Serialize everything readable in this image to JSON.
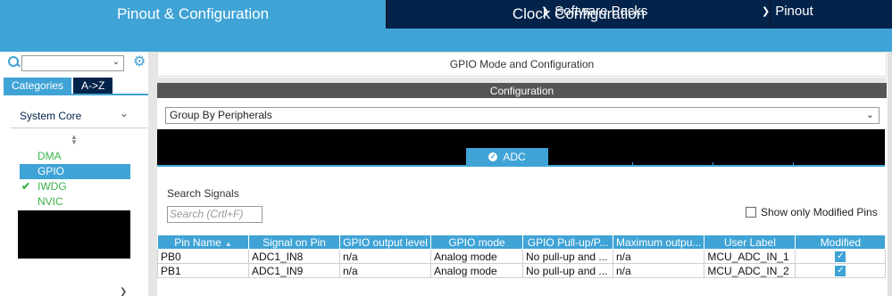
{
  "top_tabs": {
    "pinout": "Pinout & Configuration",
    "clock": "Clock Configuration"
  },
  "sub_menu": {
    "software_packs": "Software Packs",
    "pinout": "Pinout"
  },
  "left_panel": {
    "search_value": "",
    "categories_tab": "Categories",
    "az_tab": "A->Z",
    "section_title": "System Core",
    "items": [
      {
        "label": "DMA",
        "checked": false,
        "selected": false
      },
      {
        "label": "GPIO",
        "checked": false,
        "selected": true
      },
      {
        "label": "IWDG",
        "checked": true,
        "selected": false
      },
      {
        "label": "NVIC",
        "checked": false,
        "selected": false
      }
    ]
  },
  "main": {
    "title": "GPIO Mode and Configuration",
    "config_header": "Configuration",
    "group_by": "Group By Peripherals",
    "active_tab": "ADC",
    "search_signals_label": "Search Signals",
    "search_placeholder": "Search (Crtl+F)",
    "show_modified_label": "Show only Modified Pins",
    "table": {
      "columns": [
        "Pin Name",
        "Signal on Pin",
        "GPIO output level",
        "GPIO mode",
        "GPIO Pull-up/P...",
        "Maximum outpu...",
        "User Label",
        "Modified"
      ],
      "rows": [
        [
          "PB0",
          "ADC1_IN8",
          "n/a",
          "Analog mode",
          "No pull-up and ...",
          "n/a",
          "MCU_ADC_IN_1",
          true
        ],
        [
          "PB1",
          "ADC1_IN9",
          "n/a",
          "Analog mode",
          "No pull-up and ...",
          "n/a",
          "MCU_ADC_IN_2",
          true
        ]
      ]
    }
  },
  "colors": {
    "accent": "#3fa3d6",
    "dark_navy": "#03234b",
    "green": "#3cb44b"
  }
}
